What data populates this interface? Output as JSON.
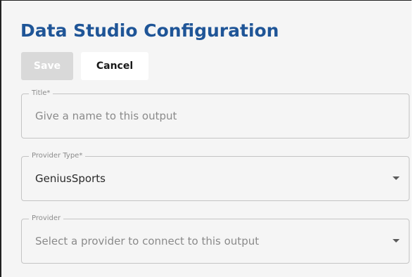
{
  "page": {
    "title": "Data Studio Configuration"
  },
  "actions": {
    "save_label": "Save",
    "cancel_label": "Cancel"
  },
  "form": {
    "title_field": {
      "label": "Title*",
      "placeholder": "Give a name to this output",
      "value": ""
    },
    "provider_type": {
      "label": "Provider Type*",
      "selected": "GeniusSports"
    },
    "provider": {
      "label": "Provider",
      "placeholder": "Select a provider to connect to this output",
      "selected": ""
    }
  },
  "icons": {
    "dropdown": "chevron-down-icon"
  },
  "colors": {
    "title": "#1f5597",
    "save_disabled": "#d9d9d9",
    "background": "#f5f5f5",
    "field_border": "#c4c4c4"
  }
}
